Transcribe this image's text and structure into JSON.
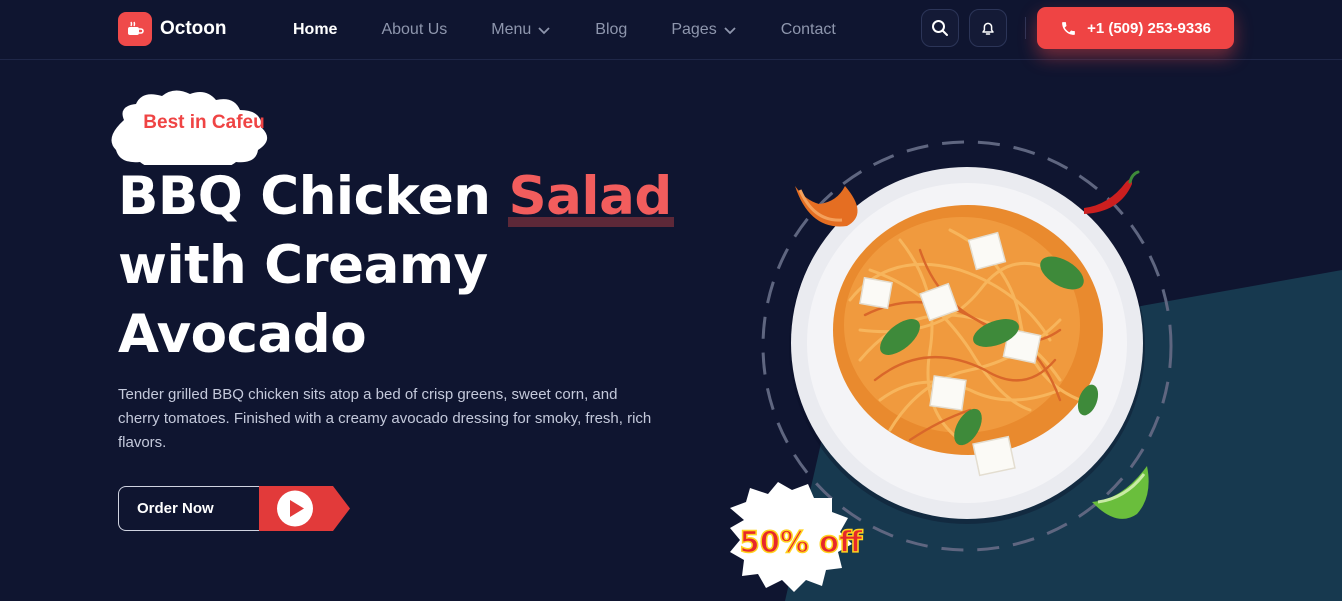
{
  "brand": {
    "name": "Octoon",
    "logo_icon": "coffee-cup-icon"
  },
  "nav": {
    "items": [
      {
        "label": "Home",
        "active": true,
        "dropdown": false
      },
      {
        "label": "About Us",
        "active": false,
        "dropdown": false
      },
      {
        "label": "Menu",
        "active": false,
        "dropdown": true
      },
      {
        "label": "Blog",
        "active": false,
        "dropdown": false
      },
      {
        "label": "Pages",
        "active": false,
        "dropdown": true
      },
      {
        "label": "Contact",
        "active": false,
        "dropdown": false
      }
    ],
    "search_icon": "search-icon",
    "bell_icon": "bell-icon",
    "phone": "+1 (509) 253-9336"
  },
  "hero": {
    "badge": "Best in Cafeu",
    "title_line1": "BBQ Chicken ",
    "title_accent": "Salad",
    "title_line2": "with Creamy",
    "title_line3": "Avocado",
    "description": "Tender grilled BBQ chicken sits atop a bed of crisp greens, sweet corn, and cherry tomatoes. Finished with a creamy avocado dressing for smoky, fresh, rich flavors.",
    "cta_label": "Order Now",
    "discount_label": "50% off"
  },
  "colors": {
    "background": "#0f1530",
    "accent": "#ef4444",
    "panel": "#17394f",
    "muted_text": "#8e96ad"
  }
}
